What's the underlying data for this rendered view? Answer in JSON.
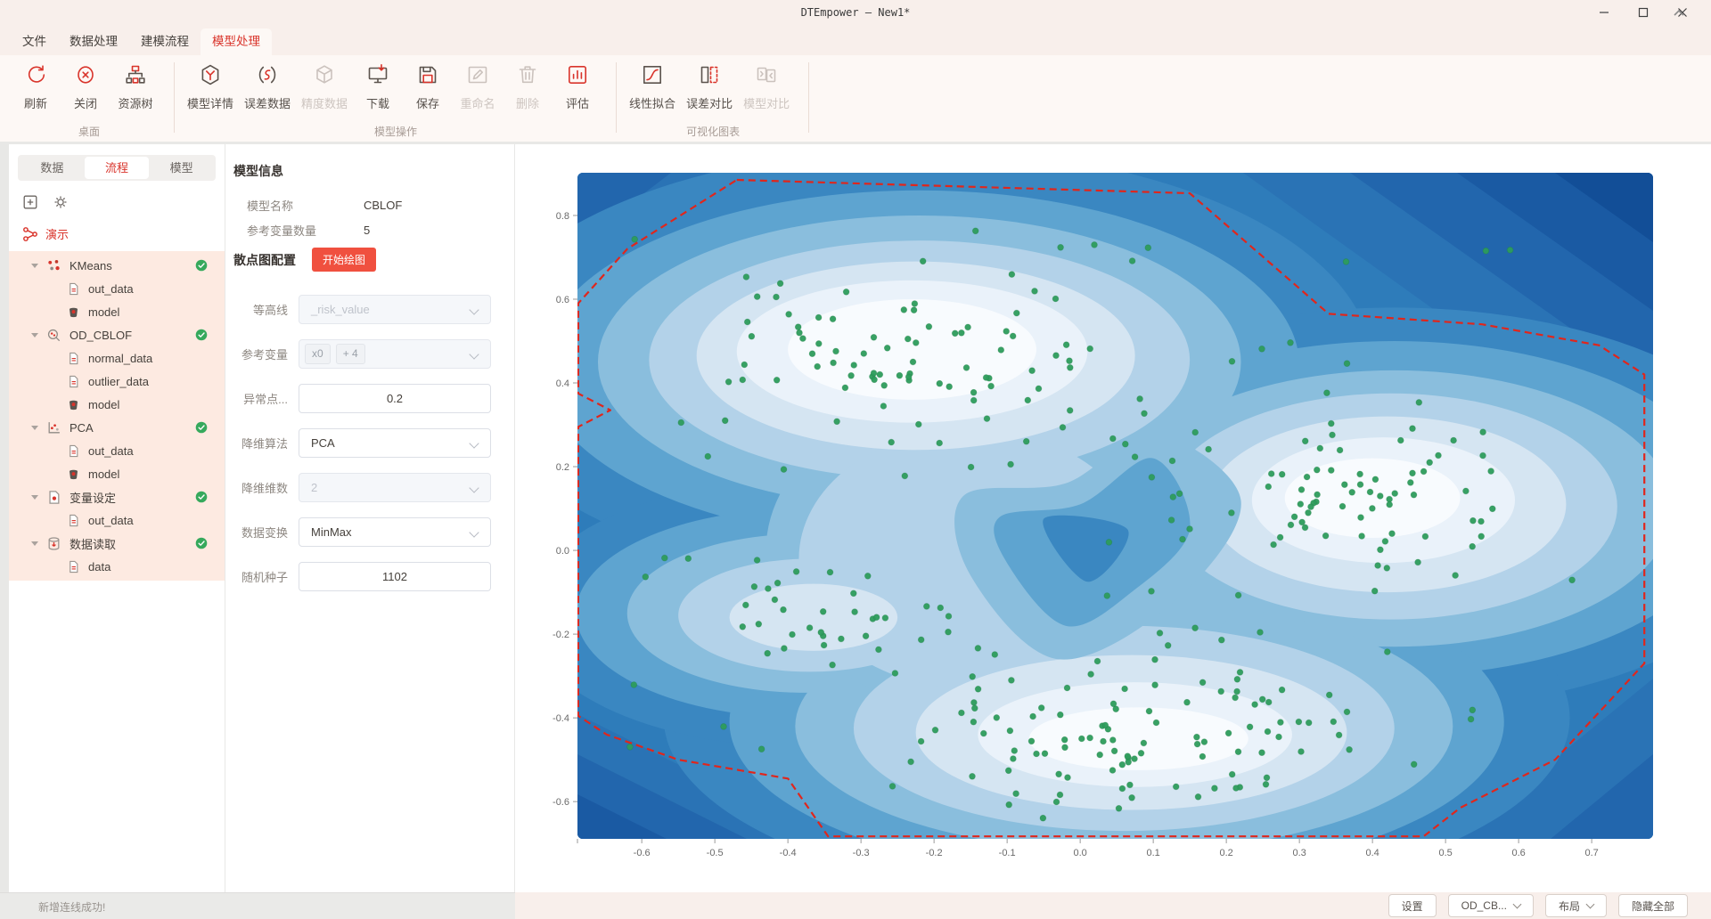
{
  "window": {
    "title": "DTEmpower — New1*",
    "controls": [
      {
        "name": "minimize"
      },
      {
        "name": "maximize"
      },
      {
        "name": "close"
      }
    ]
  },
  "menu": {
    "tabs": [
      {
        "label": "文件",
        "active": false
      },
      {
        "label": "数据处理",
        "active": false
      },
      {
        "label": "建模流程",
        "active": false
      },
      {
        "label": "模型处理",
        "active": true
      }
    ]
  },
  "ribbon": {
    "groups": [
      {
        "label": "桌面",
        "buttons": [
          {
            "label": "刷新",
            "icon": "refresh",
            "enabled": true
          },
          {
            "label": "关闭",
            "icon": "close-circle",
            "enabled": true
          },
          {
            "label": "资源树",
            "icon": "resource-tree",
            "enabled": true
          }
        ]
      },
      {
        "label": "模型操作",
        "buttons": [
          {
            "label": "模型详情",
            "icon": "hexagon-y",
            "enabled": true
          },
          {
            "label": "误差数据",
            "icon": "error-data",
            "enabled": true
          },
          {
            "label": "精度数据",
            "icon": "cube",
            "enabled": false
          },
          {
            "label": "下载",
            "icon": "download-monitor",
            "enabled": true
          },
          {
            "label": "保存",
            "icon": "save",
            "enabled": true
          },
          {
            "label": "重命名",
            "icon": "rename",
            "enabled": false
          },
          {
            "label": "删除",
            "icon": "trash",
            "enabled": false
          },
          {
            "label": "评估",
            "icon": "bar-chart",
            "enabled": true
          }
        ]
      },
      {
        "label": "可视化图表",
        "buttons": [
          {
            "label": "线性拟合",
            "icon": "fit-curve",
            "enabled": true
          },
          {
            "label": "误差对比",
            "icon": "error-compare",
            "enabled": true
          },
          {
            "label": "模型对比",
            "icon": "model-compare",
            "enabled": false
          }
        ]
      }
    ]
  },
  "sidebar": {
    "tabs": [
      {
        "label": "数据",
        "active": false
      },
      {
        "label": "流程",
        "active": true
      },
      {
        "label": "模型",
        "active": false
      }
    ],
    "toolbar_icons": [
      {
        "name": "add-node",
        "glyph": "plus-square"
      },
      {
        "name": "settings",
        "glyph": "gear"
      }
    ],
    "flow_name": "演示",
    "tree": [
      {
        "label": "KMeans",
        "icon": "kmeans",
        "status": "success",
        "children": [
          {
            "label": "out_data",
            "icon": "data-file"
          },
          {
            "label": "model",
            "icon": "model-file"
          }
        ]
      },
      {
        "label": "OD_CBLOF",
        "icon": "od-cblof",
        "status": "success",
        "children": [
          {
            "label": "normal_data",
            "icon": "data-file"
          },
          {
            "label": "outlier_data",
            "icon": "data-file"
          },
          {
            "label": "model",
            "icon": "model-file"
          }
        ]
      },
      {
        "label": "PCA",
        "icon": "pca",
        "status": "success",
        "children": [
          {
            "label": "out_data",
            "icon": "data-file"
          },
          {
            "label": "model",
            "icon": "model-file"
          }
        ]
      },
      {
        "label": "变量设定",
        "icon": "var-set",
        "status": "success",
        "children": [
          {
            "label": "out_data",
            "icon": "data-file"
          }
        ]
      },
      {
        "label": "数据读取",
        "icon": "data-read",
        "status": "success",
        "children": [
          {
            "label": "data",
            "icon": "data-file"
          }
        ]
      }
    ]
  },
  "form": {
    "title": "模型信息",
    "info_rows": [
      {
        "label": "模型名称",
        "value": "CBLOF"
      },
      {
        "label": "参考变量数量",
        "value": "5"
      }
    ],
    "section_title": "散点图配置",
    "draw_button": "开始绘图",
    "fields": [
      {
        "label": "等高线",
        "type": "select",
        "value": "_risk_value",
        "disabled": true
      },
      {
        "label": "参考变量",
        "type": "tags",
        "tags": [
          "x0",
          "+ 4"
        ],
        "disabled": true
      },
      {
        "label": "异常点...",
        "type": "number",
        "value": "0.2",
        "disabled": false
      },
      {
        "label": "降维算法",
        "type": "select",
        "value": "PCA",
        "disabled": false
      },
      {
        "label": "降维维数",
        "type": "select",
        "value": "2",
        "disabled": true
      },
      {
        "label": "数据变换",
        "type": "select",
        "value": "MinMax",
        "disabled": false
      },
      {
        "label": "随机种子",
        "type": "number",
        "value": "1102",
        "disabled": false
      }
    ]
  },
  "statusbar": {
    "message": "新增连线成功!",
    "buttons": [
      {
        "label": "设置",
        "dropdown": false
      },
      {
        "label": "OD_CB...",
        "dropdown": true
      },
      {
        "label": "布局",
        "dropdown": true
      },
      {
        "label": "隐藏全部",
        "dropdown": false
      }
    ]
  },
  "chart_data": {
    "type": "contour-scatter",
    "title": "",
    "xlabel": "",
    "ylabel": "",
    "xlim": [
      -0.688,
      0.784
    ],
    "ylim": [
      -0.689,
      0.902
    ],
    "x_ticks": [
      -0.6,
      -0.5,
      -0.4,
      -0.3,
      -0.2,
      -0.1,
      0.0,
      0.1,
      0.2,
      0.3,
      0.4,
      0.5,
      0.6,
      0.7
    ],
    "y_ticks": [
      0.8,
      0.6,
      0.4,
      0.2,
      0.0,
      -0.2,
      -0.4,
      -0.6
    ],
    "grid": false,
    "colormap": "Blues",
    "background": "#2e7cba",
    "corner_wedges": [
      [
        "tr",
        460,
        330,
        "#2a73b5"
      ],
      [
        "tr",
        340,
        240,
        "#2266ad"
      ],
      [
        "tr",
        220,
        155,
        "#1a5aa3"
      ],
      [
        "tr",
        110,
        78,
        "#124e97"
      ],
      [
        "tl",
        200,
        150,
        "#2a73b5"
      ],
      [
        "tl",
        105,
        80,
        "#2266ad"
      ],
      [
        "bl",
        280,
        140,
        "#2a73b5"
      ],
      [
        "bl",
        190,
        95,
        "#2266ad"
      ],
      [
        "bl",
        100,
        50,
        "#1a5aa3"
      ],
      [
        "br",
        220,
        180,
        "#2a73b5"
      ],
      [
        "br",
        115,
        95,
        "#2266ad"
      ]
    ],
    "bands": [
      {
        "color": "#3a87c1",
        "ellipses": [
          [
            -0.22,
            0.44,
            0.62,
            0.52
          ],
          [
            0.43,
            0.1,
            0.55,
            0.48
          ],
          [
            0.05,
            -0.4,
            0.62,
            0.44
          ],
          [
            -0.38,
            -0.15,
            0.38,
            0.32
          ],
          [
            0.0,
            0.0,
            0.5,
            0.55
          ]
        ]
      },
      {
        "color": "#5ea4d0",
        "ellipses": [
          [
            -0.22,
            0.44,
            0.52,
            0.42
          ],
          [
            0.43,
            0.1,
            0.46,
            0.4
          ],
          [
            0.05,
            -0.41,
            0.53,
            0.37
          ],
          [
            -0.38,
            -0.15,
            0.31,
            0.25
          ],
          [
            0.0,
            0.0,
            0.4,
            0.46
          ]
        ]
      },
      {
        "color": "#8abedd",
        "ellipses": [
          [
            -0.22,
            0.45,
            0.44,
            0.35
          ],
          [
            0.43,
            0.1,
            0.38,
            0.33
          ],
          [
            0.06,
            -0.42,
            0.45,
            0.3
          ],
          [
            -0.375,
            -0.15,
            0.245,
            0.19
          ],
          [
            -0.1,
            0.0,
            0.33,
            0.4
          ]
        ]
      },
      {
        "color": "#b3d2e9",
        "ellipses": [
          [
            -0.22,
            0.455,
            0.37,
            0.285
          ],
          [
            0.425,
            0.105,
            0.31,
            0.27
          ],
          [
            0.06,
            -0.425,
            0.37,
            0.245
          ],
          [
            -0.37,
            -0.155,
            0.18,
            0.135
          ],
          [
            -0.15,
            -0.02,
            0.235,
            0.31
          ]
        ]
      },
      {
        "color": "#d5e5f2",
        "ellipses": [
          [
            -0.225,
            0.465,
            0.3,
            0.225
          ],
          [
            0.42,
            0.11,
            0.245,
            0.21
          ],
          [
            0.07,
            -0.435,
            0.295,
            0.185
          ],
          [
            -0.365,
            -0.16,
            0.115,
            0.08
          ]
        ]
      },
      {
        "color": "#eaf2fa",
        "ellipses": [
          [
            -0.23,
            0.475,
            0.24,
            0.17
          ],
          [
            0.415,
            0.12,
            0.18,
            0.15
          ],
          [
            0.075,
            -0.44,
            0.215,
            0.125
          ]
        ]
      },
      {
        "color": "#f8fbfe",
        "ellipses": [
          [
            -0.23,
            0.48,
            0.17,
            0.12
          ],
          [
            0.4,
            0.125,
            0.12,
            0.095
          ],
          [
            0.08,
            -0.45,
            0.15,
            0.075
          ]
        ]
      }
    ],
    "pockets": [
      {
        "color": "#8abedd",
        "points": [
          [
            -0.16,
            0.13
          ],
          [
            -0.02,
            0.16
          ],
          [
            0.1,
            0.28
          ],
          [
            0.22,
            0.12
          ],
          [
            0.13,
            -0.12
          ],
          [
            -0.03,
            -0.26
          ],
          [
            -0.15,
            -0.06
          ]
        ]
      },
      {
        "color": "#5ea4d0",
        "points": [
          [
            -0.11,
            0.08
          ],
          [
            0.0,
            0.11
          ],
          [
            0.1,
            0.22
          ],
          [
            0.15,
            0.05
          ],
          [
            0.07,
            -0.1
          ],
          [
            -0.02,
            -0.18
          ],
          [
            -0.1,
            -0.03
          ]
        ]
      },
      {
        "color": "#3a87c1",
        "points": [
          [
            -0.05,
            0.075
          ],
          [
            0.065,
            0.05
          ],
          [
            0.01,
            -0.075
          ]
        ]
      }
    ],
    "boundary": {
      "color": "#e0261c",
      "dash": [
        8,
        5
      ],
      "width": 2.2,
      "points": [
        [
          -0.47,
          0.885
        ],
        [
          0.15,
          0.853
        ],
        [
          0.34,
          0.565
        ],
        [
          0.55,
          0.54
        ],
        [
          0.71,
          0.49
        ],
        [
          0.772,
          0.42
        ],
        [
          0.772,
          -0.27
        ],
        [
          0.65,
          -0.5
        ],
        [
          0.52,
          -0.615
        ],
        [
          0.47,
          -0.683
        ],
        [
          -0.345,
          -0.683
        ],
        [
          -0.4,
          -0.545
        ],
        [
          -0.55,
          -0.5
        ],
        [
          -0.648,
          -0.44
        ],
        [
          -0.687,
          -0.395
        ],
        [
          -0.687,
          0.295
        ],
        [
          -0.643,
          0.335
        ],
        [
          -0.687,
          0.375
        ],
        [
          -0.687,
          0.59
        ],
        [
          -0.62,
          0.72
        ]
      ]
    },
    "scatter": {
      "color": "#2d9c5c",
      "radius": 3.4,
      "seed": 7,
      "clusters": [
        {
          "cx": -0.22,
          "cy": 0.46,
          "sx": 0.155,
          "sy": 0.125,
          "n": 85
        },
        {
          "cx": 0.4,
          "cy": 0.12,
          "sx": 0.13,
          "sy": 0.115,
          "n": 75
        },
        {
          "cx": 0.07,
          "cy": -0.43,
          "sx": 0.15,
          "sy": 0.1,
          "n": 95
        },
        {
          "cx": -0.36,
          "cy": -0.16,
          "sx": 0.075,
          "sy": 0.055,
          "n": 28
        }
      ],
      "uniform": {
        "n": 60,
        "x": [
          -0.63,
          0.72
        ],
        "y": [
          -0.655,
          0.82
        ]
      }
    }
  }
}
